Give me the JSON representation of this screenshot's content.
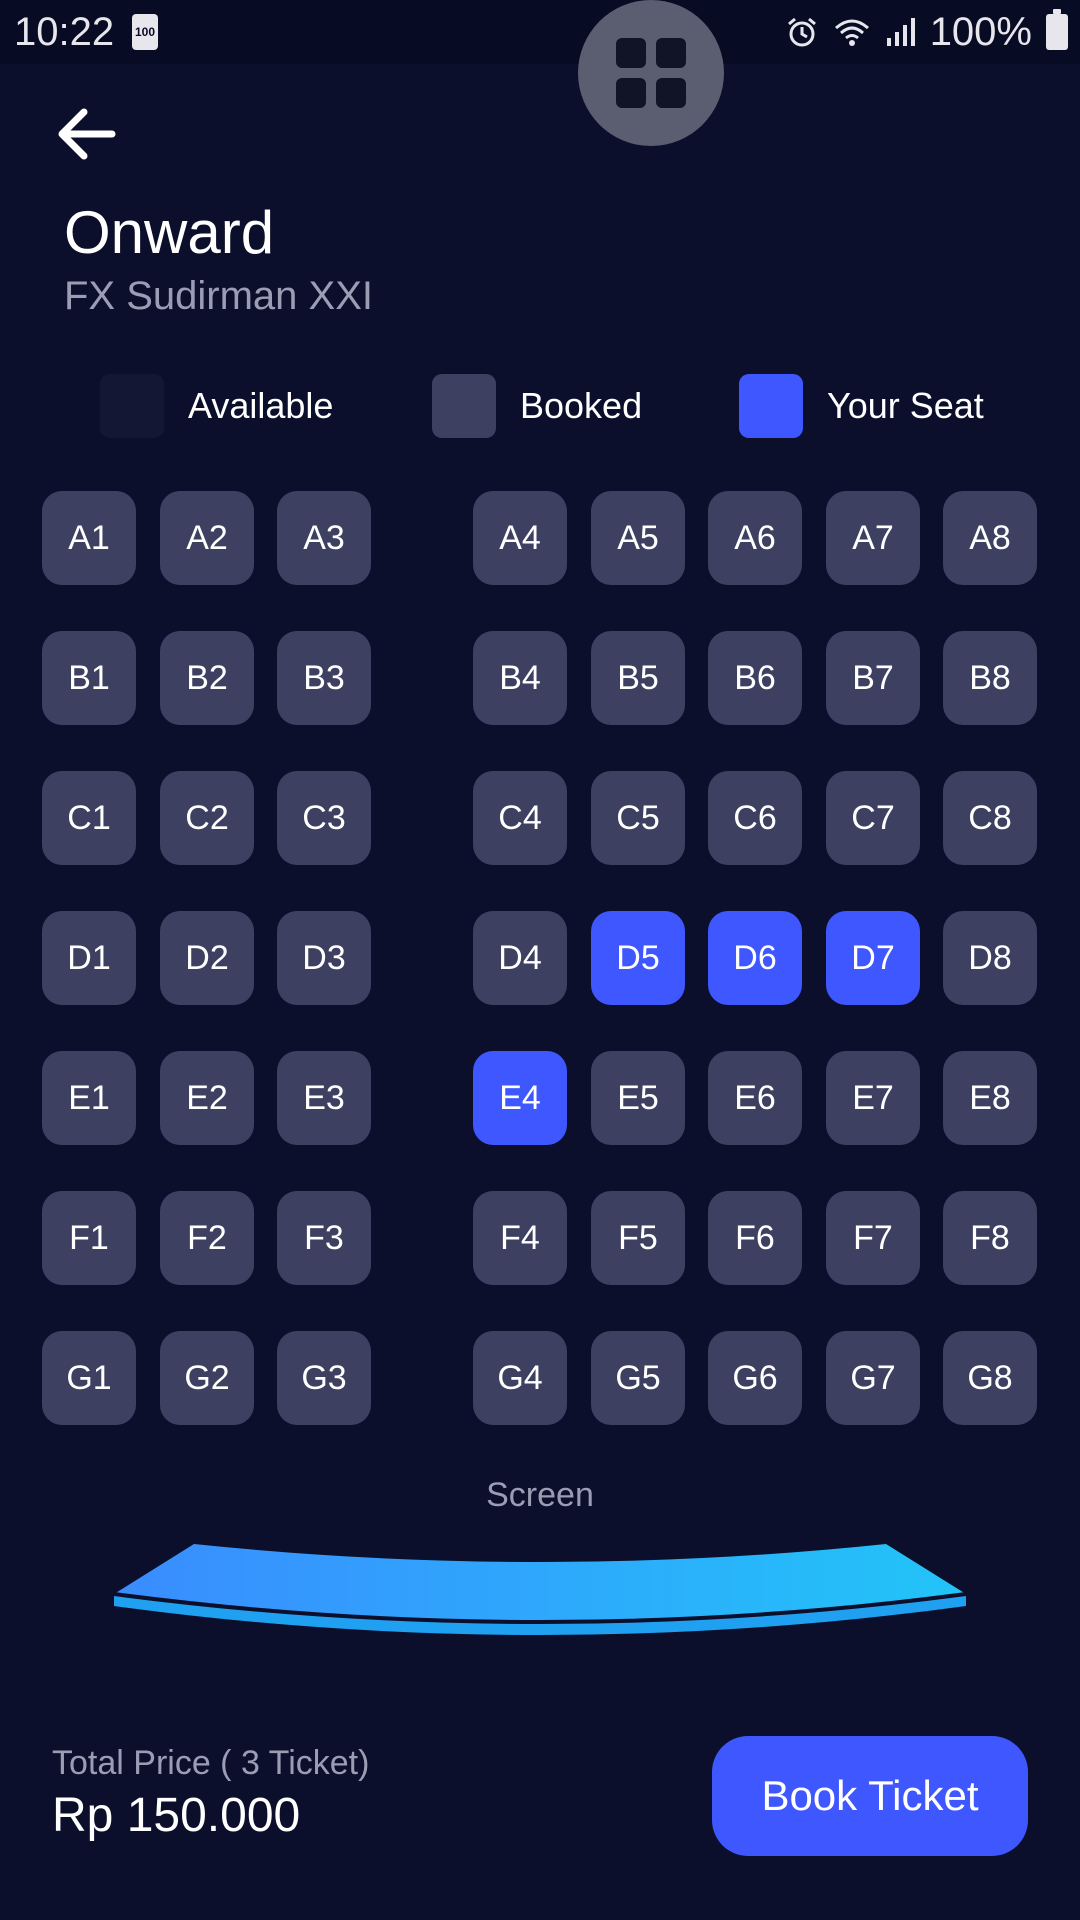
{
  "status_bar": {
    "time": "10:22",
    "battery_badge": "100",
    "battery_percent": "100%",
    "icons": [
      "alarm-icon",
      "wifi-icon",
      "signal-icon",
      "battery-icon"
    ]
  },
  "header": {
    "movie_title": "Onward",
    "cinema": "FX Sudirman XXI"
  },
  "legend": {
    "available": "Available",
    "booked": "Booked",
    "your_seat": "Your Seat"
  },
  "colors": {
    "background": "#0B0F2B",
    "available": "#141733",
    "booked": "#3E4061",
    "your_seat": "#3F57FF",
    "screen": "#2FA8FF"
  },
  "seats": {
    "rows": [
      "A",
      "B",
      "C",
      "D",
      "E",
      "F",
      "G"
    ],
    "columns": [
      1,
      2,
      3,
      4,
      5,
      6,
      7,
      8
    ],
    "selected": [
      "D5",
      "D6",
      "D7",
      "E4"
    ]
  },
  "screen": {
    "label": "Screen"
  },
  "footer": {
    "total_caption": "Total Price ( 3 Ticket)",
    "total_price": "Rp 150.000",
    "book_button": "Book Ticket"
  }
}
